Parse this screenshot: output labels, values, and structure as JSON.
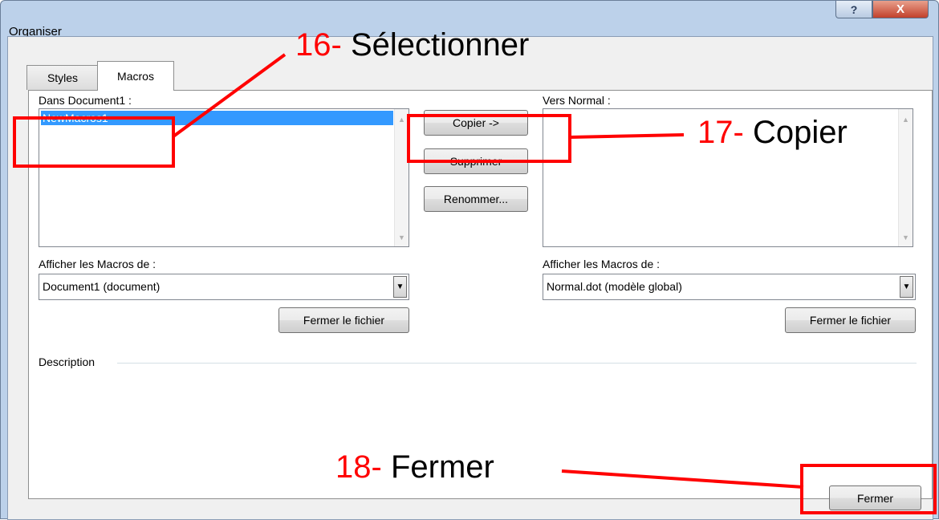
{
  "window": {
    "title": "Organiser",
    "help_glyph": "?",
    "close_glyph": "X"
  },
  "tabs": [
    {
      "label": "Styles"
    },
    {
      "label": "Macros"
    }
  ],
  "left": {
    "list_label": "Dans Document1 :",
    "items": [
      "NewMacros1"
    ],
    "selected_index": 0,
    "show_label": "Afficher les Macros de :",
    "combo_value": "Document1 (document)",
    "close_file_button": "Fermer le fichier"
  },
  "right": {
    "list_label": "Vers Normal :",
    "show_label": "Afficher les Macros de :",
    "combo_value": "Normal.dot (modèle global)",
    "close_file_button": "Fermer le fichier"
  },
  "center_buttons": {
    "copy": "Copier ->",
    "delete": "Supprimer",
    "rename": "Renommer..."
  },
  "description_label": "Description",
  "footer": {
    "close_button": "Fermer"
  },
  "annotations": {
    "step16": {
      "num": "16-",
      "text": "Sélectionner"
    },
    "step17": {
      "num": "17-",
      "text": "Copier"
    },
    "step18": {
      "num": "18-",
      "text": "Fermer"
    }
  },
  "colors": {
    "annotation": "#ff0000",
    "selection": "#3399ff",
    "chrome": "#bcd1ea"
  }
}
